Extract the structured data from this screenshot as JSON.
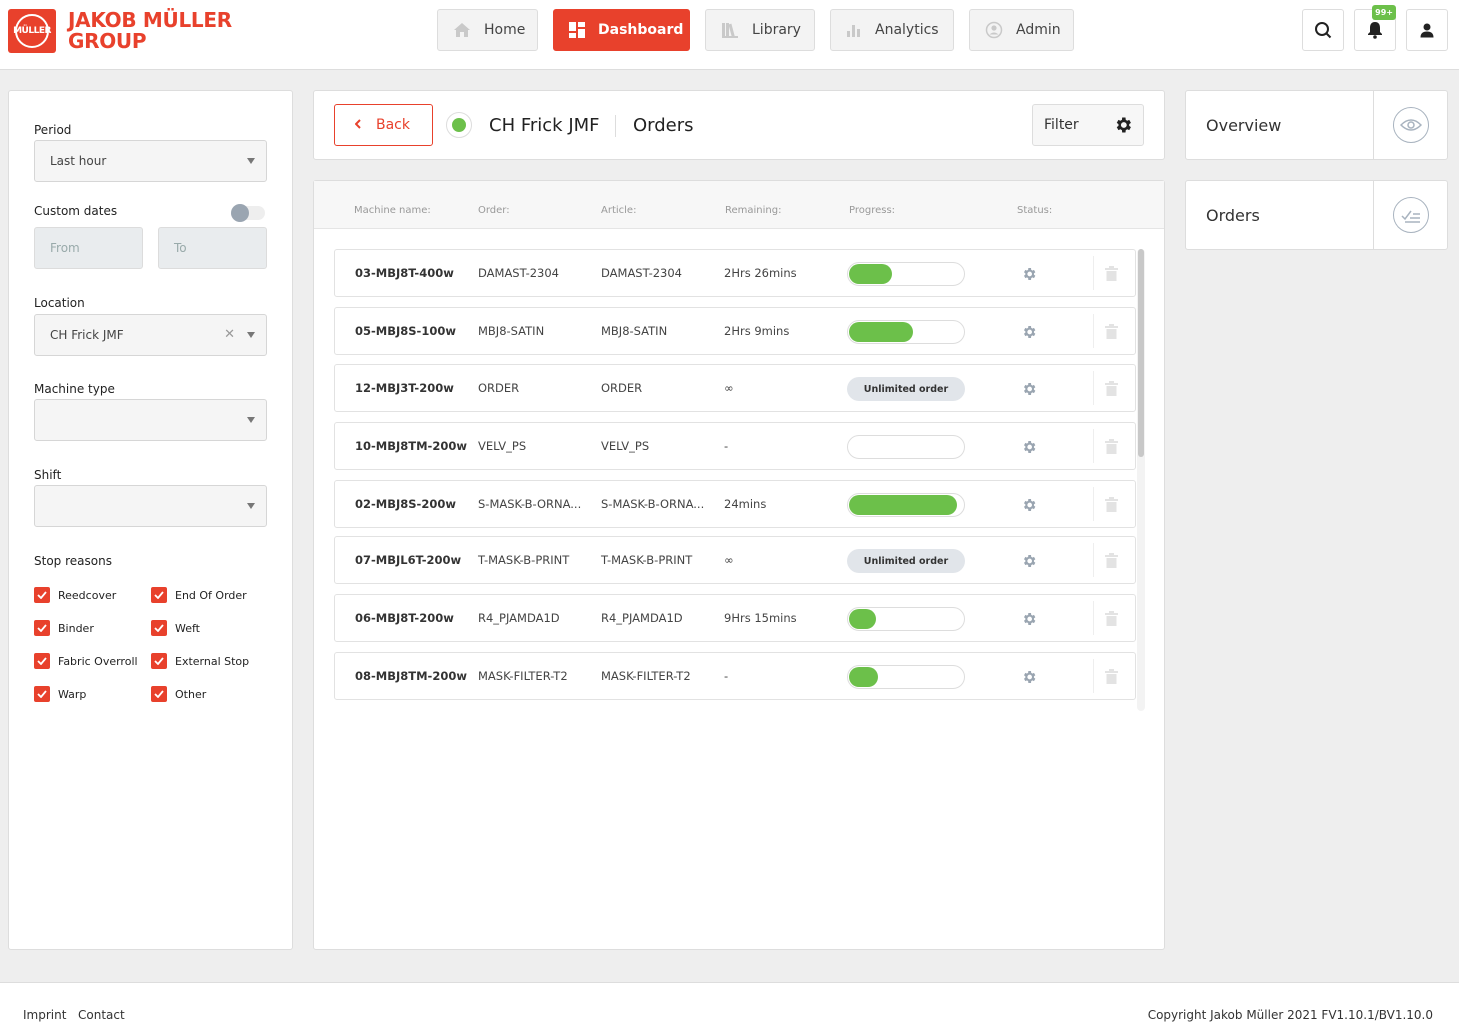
{
  "brand": {
    "line1": "JAKOB MÜLLER",
    "line2": "GROUP",
    "mark": "MÜLLER",
    "color": "#e8412c"
  },
  "nav": {
    "home": "Home",
    "dashboard": "Dashboard",
    "library": "Library",
    "analytics": "Analytics",
    "admin": "Admin"
  },
  "notifications": {
    "badge": "99+"
  },
  "filters": {
    "period_label": "Period",
    "period_value": "Last hour",
    "custom_dates_label": "Custom dates",
    "from_placeholder": "From",
    "to_placeholder": "To",
    "location_label": "Location",
    "location_value": "CH Frick JMF",
    "machine_type_label": "Machine type",
    "machine_type_value": "",
    "shift_label": "Shift",
    "shift_value": "",
    "stop_reasons_label": "Stop reasons",
    "stop_reasons": [
      "Reedcover",
      "End Of Order",
      "Binder",
      "Weft",
      "Fabric Overroll",
      "External Stop",
      "Warp",
      "Other"
    ]
  },
  "header": {
    "back": "Back",
    "location": "CH Frick JMF",
    "section": "Orders",
    "filter": "Filter",
    "status_color": "#6cc04a"
  },
  "table": {
    "headers": {
      "machine": "Machine name:",
      "order": "Order:",
      "article": "Article:",
      "remaining": "Remaining:",
      "progress": "Progress:",
      "status": "Status:"
    },
    "rows": [
      {
        "machine": "03-MBJ8T-400w",
        "order": "DAMAST-2304",
        "article": "DAMAST-2304",
        "remaining": "2Hrs 26mins",
        "progress": 0.37,
        "unlimited": ""
      },
      {
        "machine": "05-MBJ8S-100w",
        "order": "MBJ8-SATIN",
        "article": "MBJ8-SATIN",
        "remaining": "2Hrs 9mins",
        "progress": 0.55,
        "unlimited": ""
      },
      {
        "machine": "12-MBJ3T-200w",
        "order": "ORDER",
        "article": "ORDER",
        "remaining": "∞",
        "progress": null,
        "unlimited": "Unlimited order"
      },
      {
        "machine": "10-MBJ8TM-200w",
        "order": "VELV_PS",
        "article": "VELV_PS",
        "remaining": "-",
        "progress": 0,
        "unlimited": ""
      },
      {
        "machine": "02-MBJ8S-200w",
        "order": "S-MASK-B-ORNA...",
        "article": "S-MASK-B-ORNA...",
        "remaining": "24mins",
        "progress": 0.93,
        "unlimited": ""
      },
      {
        "machine": "07-MBJL6T-200w",
        "order": "T-MASK-B-PRINT",
        "article": "T-MASK-B-PRINT",
        "remaining": "∞",
        "progress": null,
        "unlimited": "Unlimited order"
      },
      {
        "machine": "06-MBJ8T-200w",
        "order": "R4_PJAMDA1D",
        "article": "R4_PJAMDA1D",
        "remaining": "9Hrs 15mins",
        "progress": 0.23,
        "unlimited": ""
      },
      {
        "machine": "08-MBJ8TM-200w",
        "order": "MASK-FILTER-T2",
        "article": "MASK-FILTER-T2",
        "remaining": "-",
        "progress": 0.25,
        "unlimited": ""
      }
    ]
  },
  "side": {
    "overview": "Overview",
    "orders": "Orders"
  },
  "footer": {
    "imprint": "Imprint",
    "contact": "Contact",
    "copyright": "Copyright Jakob Müller 2021 FV1.10.1/BV1.10.0"
  }
}
